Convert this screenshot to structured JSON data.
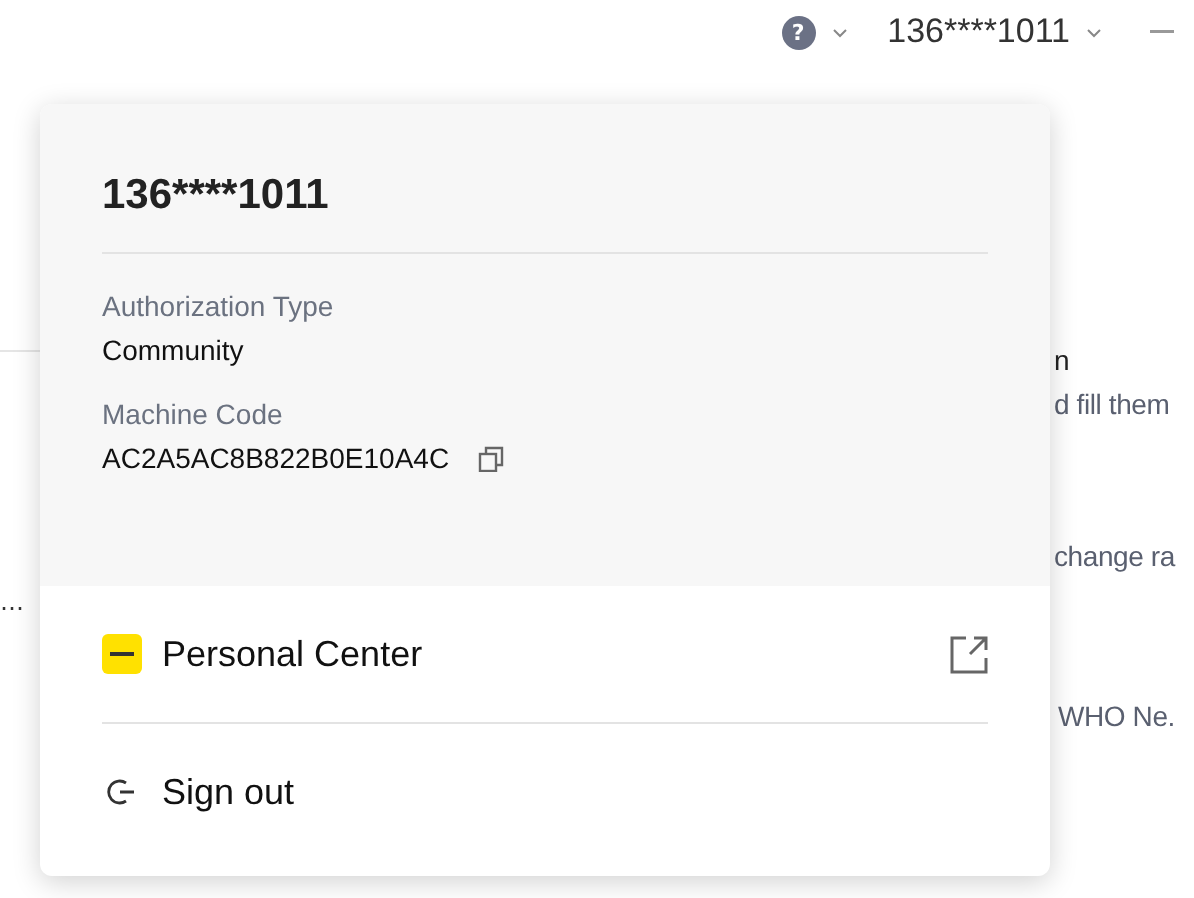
{
  "top_bar": {
    "help_icon_text": "?",
    "account": "136****1011"
  },
  "background_text": [
    "n",
    "d fill them",
    "change ra",
    "WHO Ne."
  ],
  "left_fragment": "…",
  "account_popup": {
    "name": "136****1011",
    "fields": [
      {
        "label": "Authorization Type",
        "value": "Community",
        "kind": "plain"
      },
      {
        "label": "Machine Code",
        "value": "AC2A5AC8B822B0E10A4C",
        "kind": "copyable"
      }
    ],
    "menu": [
      {
        "label": "Personal Center",
        "kind": "external"
      },
      {
        "label": "Sign out",
        "kind": "signout"
      }
    ]
  }
}
